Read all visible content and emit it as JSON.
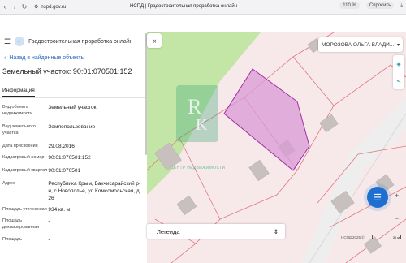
{
  "browser": {
    "url": "nspd.gov.ru",
    "tab_title": "НСПД | Градостроительная проработка онлайн",
    "zoom": "110 %",
    "ask_label": "Спросить"
  },
  "app": {
    "title": "Градостроительная проработка онлайн"
  },
  "panel": {
    "back_label": "Назад в найденные объекты",
    "parcel_title": "Земельный участок: 90:01:070501:152",
    "tab_info": "Информация",
    "fields": [
      {
        "key": "Вид объекта недвижимости",
        "value": "Земельный участок"
      },
      {
        "key": "Вид земельного участка",
        "value": "Землепользование"
      },
      {
        "key": "Дата присвоения",
        "value": "29.08.2016"
      },
      {
        "key": "Кадастровый номер",
        "value": "90:01:070501:152"
      },
      {
        "key": "Кадастровый квартал",
        "value": "90:01:070501"
      },
      {
        "key": "Адрес",
        "value": "Республика Крым, Бахчисарайский р-н, с Новополье, ул Комсомольская, д 26"
      },
      {
        "key": "Площадь уточненная",
        "value": "934 кв. м"
      },
      {
        "key": "Площадь декларированная",
        "value": "-"
      },
      {
        "key": "Площадь",
        "value": "-"
      }
    ]
  },
  "map": {
    "owner_select": "МОРОЗОВА ОЛЬГА ВЛАДИ...",
    "legend_label": "Легенда",
    "copyright": "НСПД 2025 ©",
    "scale": "30 м",
    "watermark_sub": "ЦЕНТР НЕДВИЖИМОСТИ",
    "colors": {
      "parcel_fill": "#d99ad6",
      "parcel_stroke": "#a12fa0",
      "green_area": "#c3e6a6",
      "boundary": "#e0777f"
    }
  }
}
